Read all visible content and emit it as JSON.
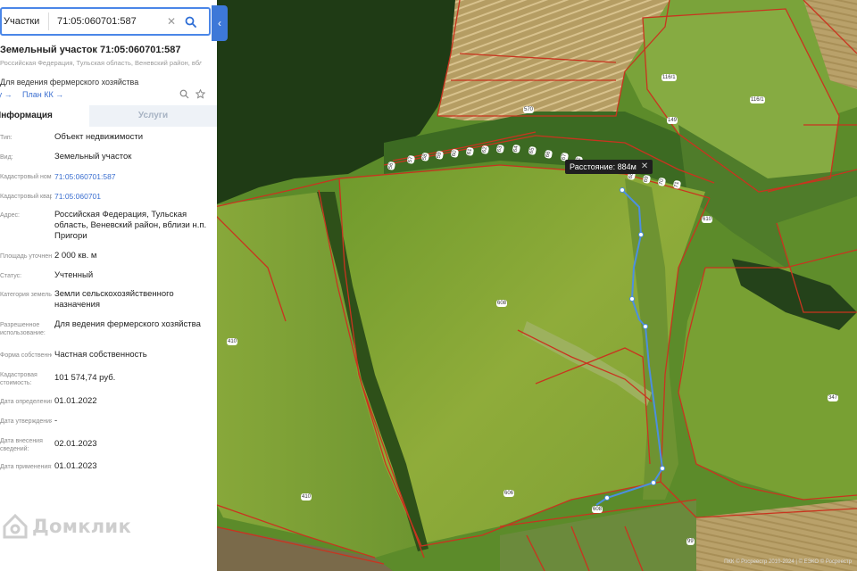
{
  "search": {
    "category": "Участки",
    "query": "71:05:060701:587"
  },
  "card": {
    "title": "Земельный участок 71:05:060701:587",
    "address": "Российская Федерация, Тульская область, Веневский район, вблизи н.п. Пригори",
    "purpose": "Для ведения фермерского хозяйства",
    "links": [
      "Пусту →",
      "План КК →"
    ]
  },
  "tabs": {
    "info": "Информация",
    "services": "Услуги"
  },
  "details": [
    {
      "label": "Тип:",
      "value": "Объект недвижимости"
    },
    {
      "label": "Вид:",
      "value": "Земельный участок"
    },
    {
      "label": "Кадастровый номер:",
      "value": "71:05:060701:587",
      "link": true
    },
    {
      "label": "Кадастровый квартал:",
      "value": "71:05:060701",
      "link": true
    },
    {
      "label": "Адрес:",
      "value": "Российская Федерация, Тульская область, Веневский район, вблизи н.п. Пригори"
    },
    {
      "label": "Площадь уточненная:",
      "value": "2 000 кв. м"
    },
    {
      "label": "Статус:",
      "value": "Учтенный"
    },
    {
      "label": "Категория земель:",
      "value": "Земли сельскохозяйственного назначения"
    },
    {
      "label": "Разрешенное использование:",
      "value": "Для ведения фермерского хозяйства"
    },
    {
      "label": "Форма собственности:",
      "value": "Частная собственность"
    },
    {
      "label": "Кадастровая стоимость:",
      "value": "101 574,74 руб."
    },
    {
      "label": "Дата определения:",
      "value": "01.01.2022"
    },
    {
      "label": "Дата утверждения:",
      "value": "-"
    },
    {
      "label": "Дата внесения сведений:",
      "value": "02.01.2023"
    },
    {
      "label": "Дата применения:",
      "value": "01.01.2023"
    }
  ],
  "watermark": "Домклик",
  "map": {
    "distance_label": "Расстояние: 884м",
    "plot_labels": [
      "116/1",
      "116/1",
      "570",
      "149",
      "610",
      "608",
      "606",
      "608",
      "410",
      "410",
      "347",
      "99",
      "56",
      "57",
      "58",
      "59",
      "60",
      "61",
      "62",
      "63",
      "64",
      "65",
      "66",
      "67",
      "68",
      "69",
      "70",
      "71",
      "72"
    ],
    "copyright": "ПКК © Росреестр 2010-2024 | © ЕЭКО © Росреестр"
  }
}
